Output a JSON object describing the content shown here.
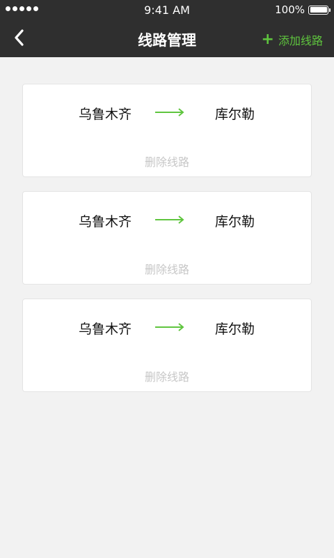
{
  "status_bar": {
    "time": "9:41 AM",
    "battery": "100%",
    "battery_level": 1.0
  },
  "nav": {
    "title": "线路管理",
    "back_icon": "chevron-left-icon",
    "add_label": "添加线路",
    "add_icon": "plus-icon",
    "accent_color": "#5fc53e"
  },
  "routes": [
    {
      "from": "乌鲁木齐",
      "to": "库尔勒",
      "delete_label": "删除线路"
    },
    {
      "from": "乌鲁木齐",
      "to": "库尔勒",
      "delete_label": "删除线路"
    },
    {
      "from": "乌鲁木齐",
      "to": "库尔勒",
      "delete_label": "删除线路"
    }
  ]
}
